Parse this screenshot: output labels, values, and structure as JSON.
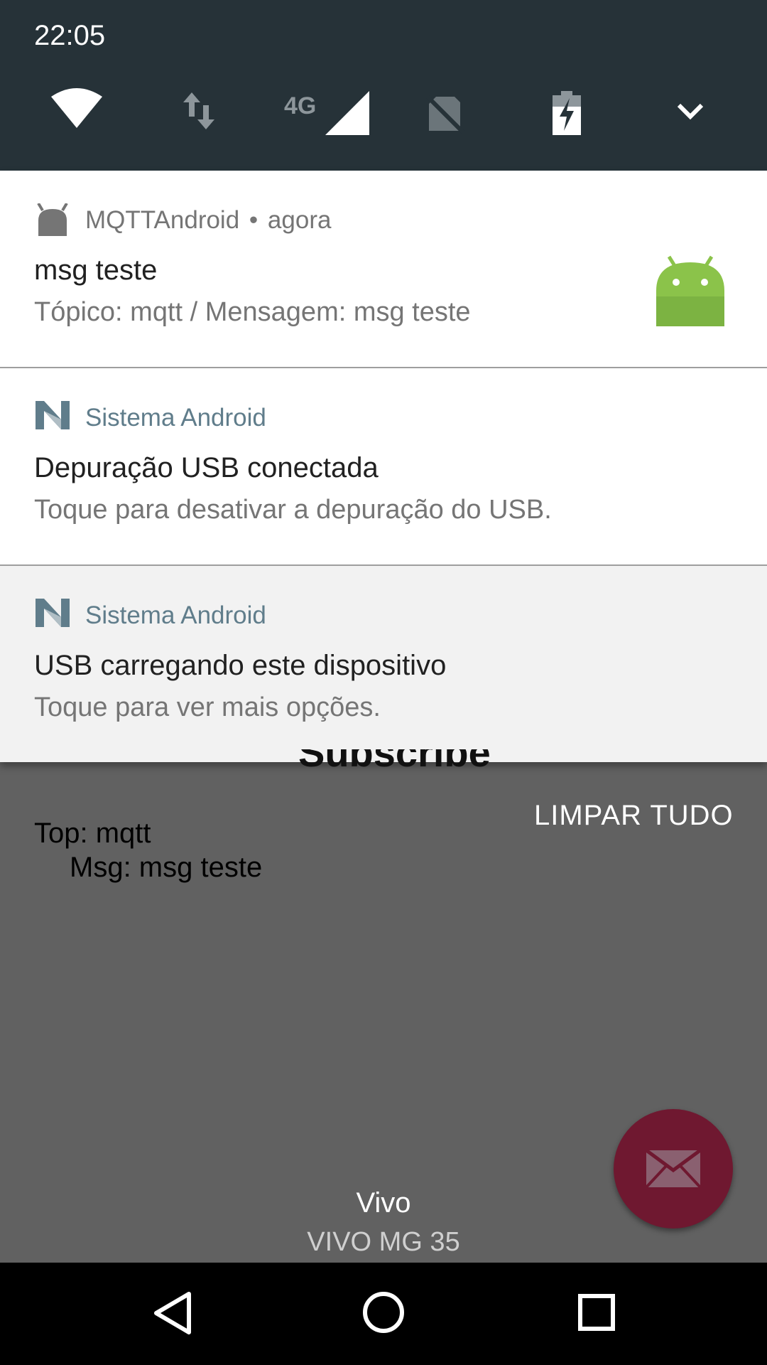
{
  "status_bar": {
    "time": "22:05"
  },
  "quick_settings": {
    "icons": [
      "wifi-icon",
      "data-transfer-icon",
      "cellular-4g-icon",
      "no-sim-icon",
      "battery-charging-icon",
      "expand-icon"
    ],
    "network_type": "4G"
  },
  "notifications": [
    {
      "app_name": "MQTTAndroid",
      "separator": "•",
      "time": "agora",
      "title": "msg teste",
      "text": "Tópico: mqtt / Mensagem: msg teste"
    },
    {
      "app_name": "Sistema Android",
      "title": "Depuração USB conectada",
      "text": "Toque para desativar a depuração do USB."
    },
    {
      "app_name": "Sistema Android",
      "title": "USB carregando este dispositivo",
      "text": "Toque para ver mais opções."
    }
  ],
  "clear_all_label": "LIMPAR TUDO",
  "background_app": {
    "partial_title": "Subscribe",
    "line1": "Top: mqtt",
    "line2": "Msg: msg teste"
  },
  "carrier": {
    "name": "Vivo",
    "sub": "VIVO MG 35"
  },
  "colors": {
    "header": "#263238",
    "fab": "#6f1830",
    "system_app_name": "#607d8b",
    "android_green": "#8bc34a"
  }
}
